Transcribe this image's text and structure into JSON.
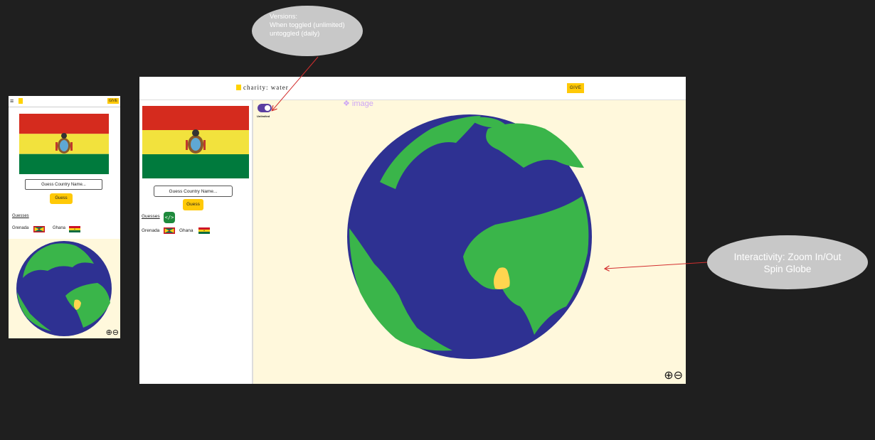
{
  "mobile": {
    "menu_icon": "hamburger-icon",
    "give_label": "GIVE",
    "guess_placeholder": "Guess Country Name...",
    "guess_button": "Guess",
    "guesses_label": "Guesses",
    "guesses": [
      {
        "name": "Grenada",
        "flag": "grenada-flag-icon"
      },
      {
        "name": "Ghana",
        "flag": "ghana-flag-icon"
      }
    ],
    "zoom_in_icon": "zoom-in-icon",
    "zoom_out_icon": "zoom-out-icon"
  },
  "desktop": {
    "brand": "charity: water",
    "give_label": "GIVE",
    "guess_placeholder": "Guess Country Name...",
    "guess_button": "Guess",
    "guesses_label": "Guesses",
    "code_icon": "code-icon",
    "guesses": [
      {
        "name": "Grenada",
        "flag": "grenada-flag-icon"
      },
      {
        "name": "Ghana",
        "flag": "ghana-flag-icon"
      }
    ],
    "toggle": {
      "label": "Unlimited",
      "state": "on"
    },
    "image_tag": "❖ image",
    "zoom_in_icon": "zoom-in-icon",
    "zoom_out_icon": "zoom-out-icon"
  },
  "annotations": {
    "versions": {
      "line1": "Versions:",
      "line2": "When toggled (unlimited)",
      "line3": "untoggled (daily)"
    },
    "interactivity": {
      "line1": "Interactivity: Zoom In/Out",
      "line2": "Spin Globe"
    }
  },
  "colors": {
    "background": "#1f1f1f",
    "accent_yellow": "#ffc907",
    "map_background": "#fff8dc",
    "ocean": "#2e3192",
    "land": "#3ab54a",
    "highlight": "#ffd54f",
    "toggle": "#5b3fa0",
    "bolivia_red": "#d52b1e",
    "bolivia_yellow": "#f2e23d",
    "bolivia_green": "#007a3d",
    "arrow": "#d32f2f"
  },
  "flag_shown": "bolivia-flag"
}
